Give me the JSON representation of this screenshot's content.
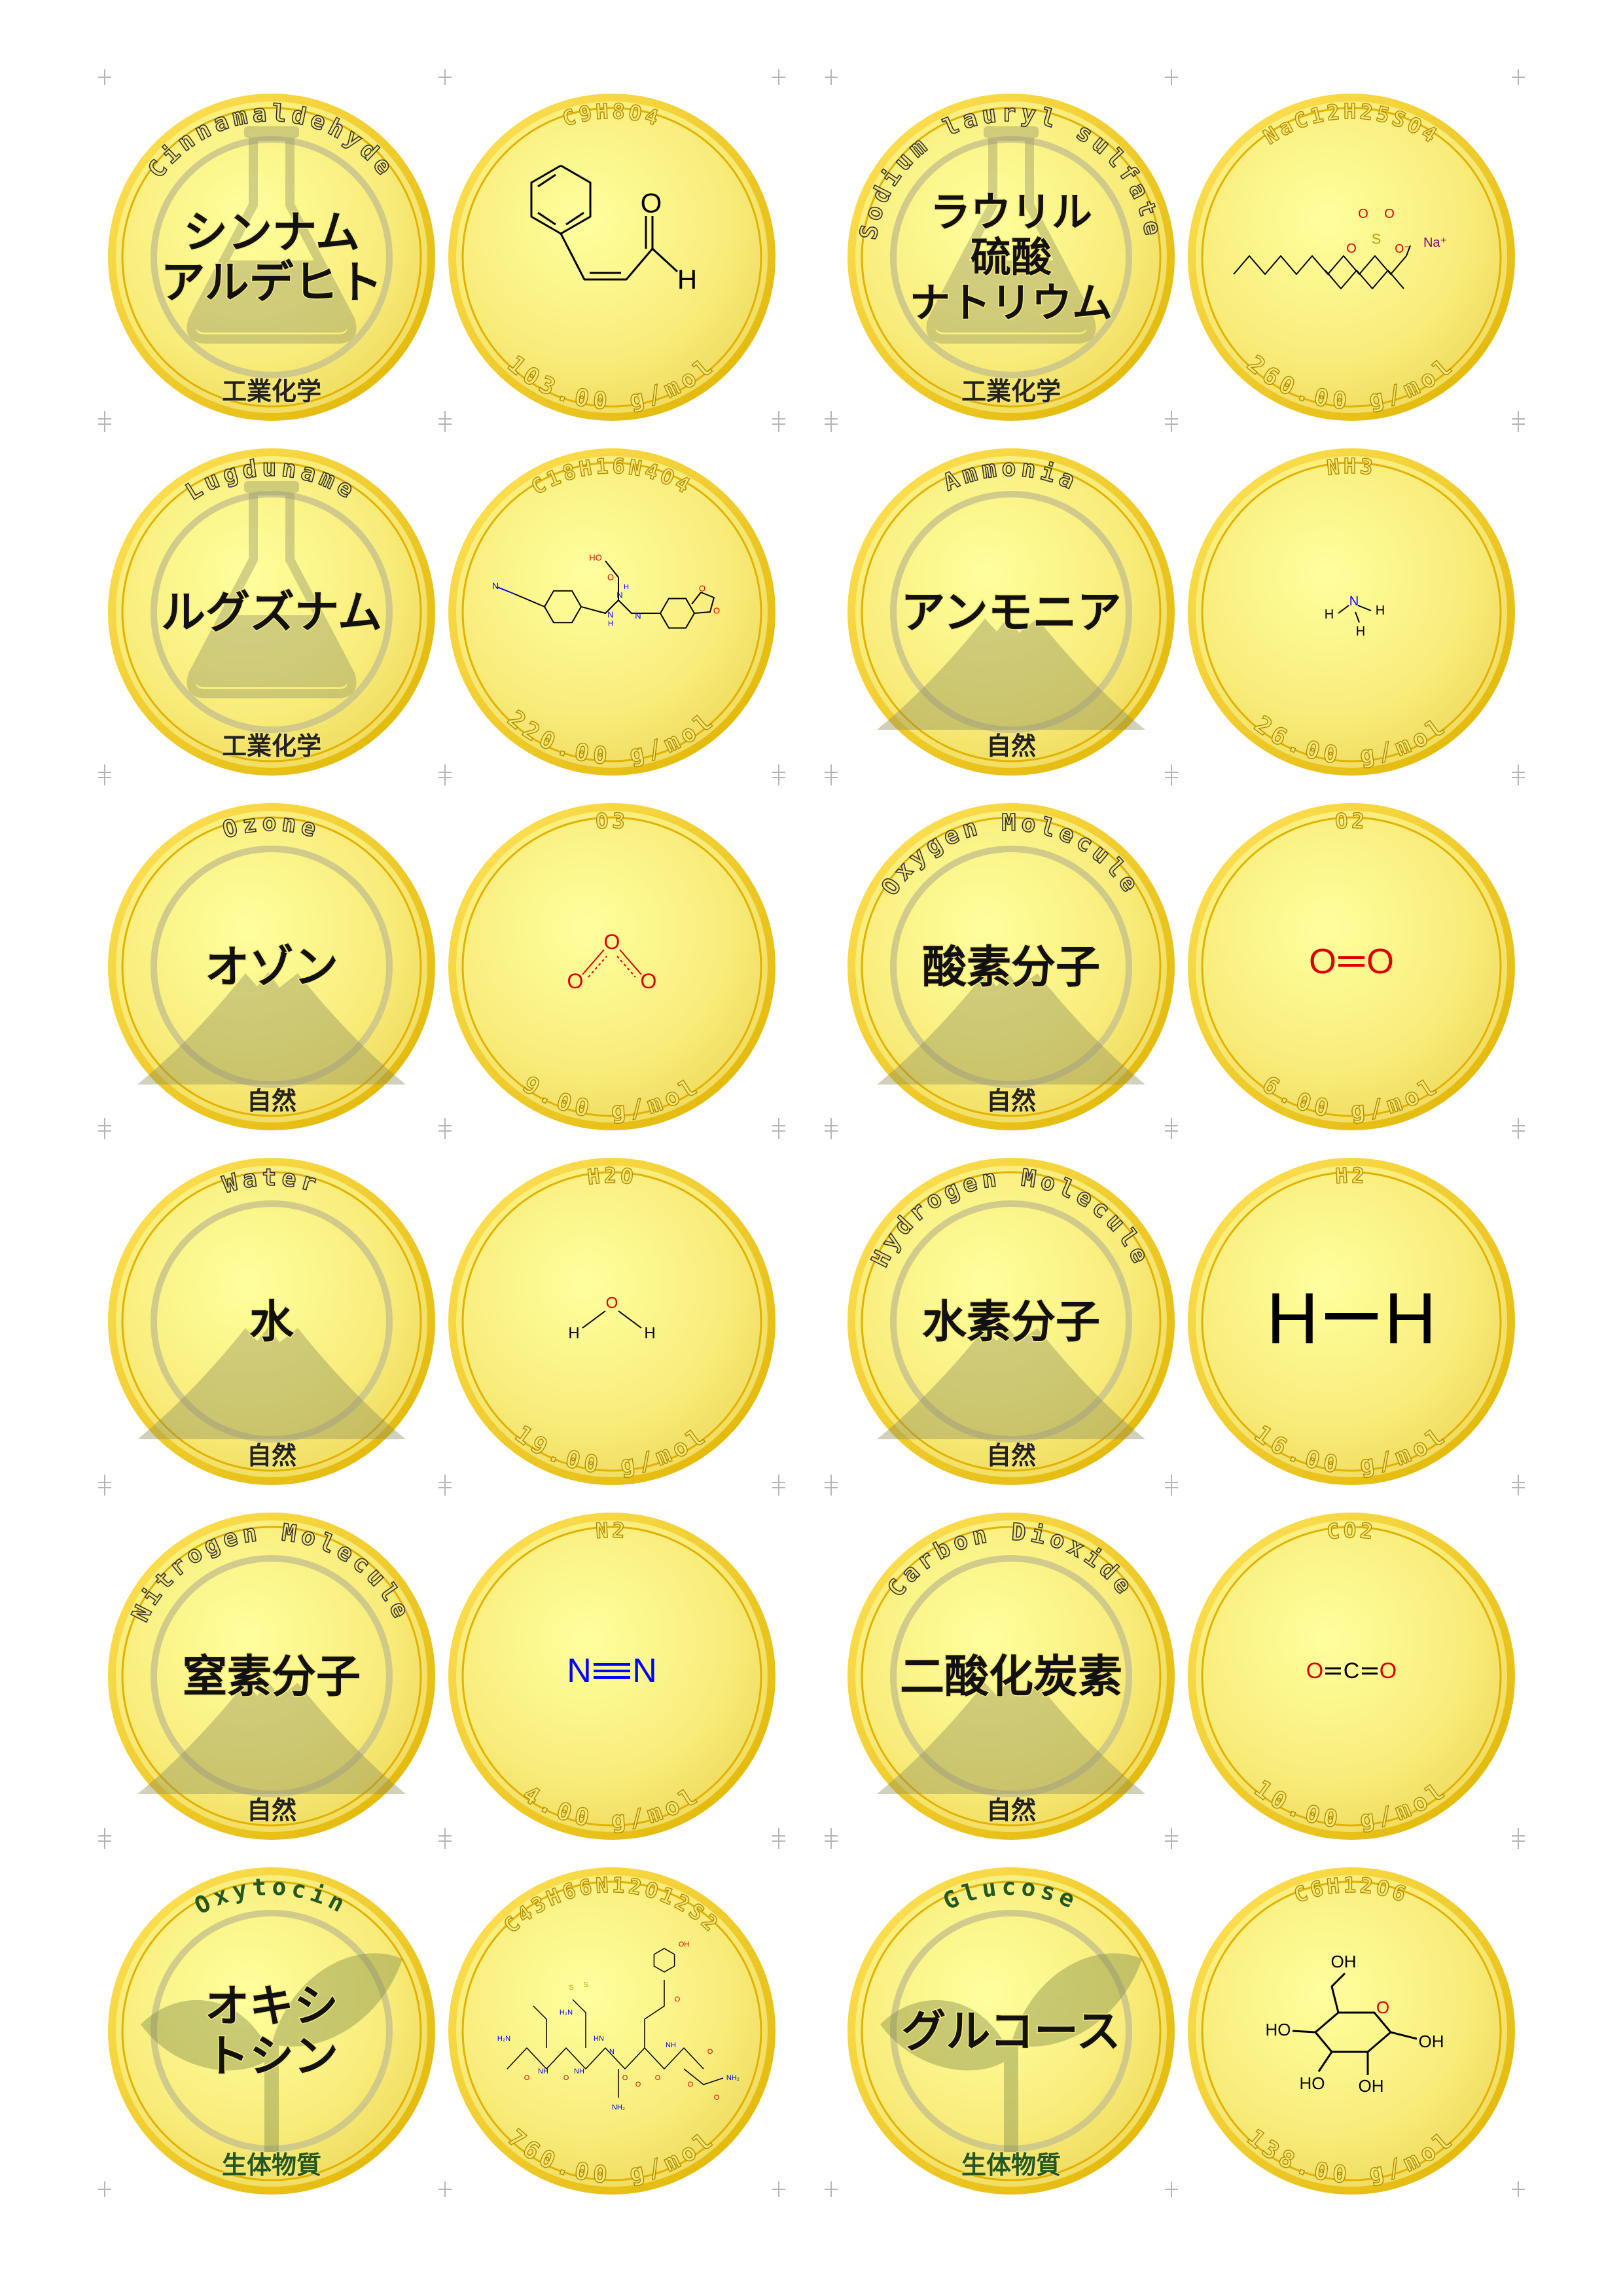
{
  "colors": {
    "coin_light": "#FFFF99",
    "coin_mid": "#F5E36A",
    "coin_rim": "#E6B800",
    "front_text": "#111111",
    "front_stroke_gold": "#F7E774",
    "bio_green": "#235723"
  },
  "coins": [
    {
      "en": "Cinnamaldehyde",
      "jp": [
        "シンナム",
        "アルデヒト"
      ],
      "category": "工業化学",
      "kind": "industrial",
      "icon": "flask-icon",
      "formula": "C9H8O4",
      "mass": "103.00 g/mol",
      "molecule": "cinnamaldehyde"
    },
    {
      "en": "Sodium lauryl sulfate",
      "jp": [
        "ラウリル",
        "硫酸",
        "ナトリウム"
      ],
      "category": "工業化学",
      "kind": "industrial",
      "icon": "flask-icon",
      "formula": "NaC12H25SO4",
      "mass": "260.00 g/mol",
      "molecule": "sls"
    },
    {
      "en": "Lugduname",
      "jp": [
        "ルグズナム"
      ],
      "category": "工業化学",
      "kind": "industrial",
      "icon": "flask-icon",
      "formula": "C18H16N4O4",
      "mass": "220.00 g/mol",
      "molecule": "lugduname"
    },
    {
      "en": "Ammonia",
      "jp": [
        "アンモニア"
      ],
      "category": "自然",
      "kind": "nature",
      "icon": "mountain-icon",
      "formula": "NH3",
      "mass": "26.00 g/mol",
      "molecule": "nh3"
    },
    {
      "en": "Ozone",
      "jp": [
        "オゾン"
      ],
      "category": "自然",
      "kind": "nature",
      "icon": "mountain-icon",
      "formula": "O3",
      "mass": "9.00 g/mol",
      "molecule": "o3"
    },
    {
      "en": "Oxygen Molecule",
      "jp": [
        "酸素分子"
      ],
      "category": "自然",
      "kind": "nature",
      "icon": "mountain-icon",
      "formula": "O2",
      "mass": "6.00 g/mol",
      "molecule": "o2"
    },
    {
      "en": "Water",
      "jp": [
        "水"
      ],
      "category": "自然",
      "kind": "nature",
      "icon": "mountain-icon",
      "formula": "H2O",
      "mass": "19.00 g/mol",
      "molecule": "h2o"
    },
    {
      "en": "Hydrogen Molecule",
      "jp": [
        "水素分子"
      ],
      "category": "自然",
      "kind": "nature",
      "icon": "mountain-icon",
      "formula": "H2",
      "mass": "16.00 g/mol",
      "molecule": "h2"
    },
    {
      "en": "Nitrogen Molecule",
      "jp": [
        "窒素分子"
      ],
      "category": "自然",
      "kind": "nature",
      "icon": "mountain-icon",
      "formula": "N2",
      "mass": "4.00 g/mol",
      "molecule": "n2"
    },
    {
      "en": "Carbon Dioxide",
      "jp": [
        "二酸化炭素"
      ],
      "category": "自然",
      "kind": "nature",
      "icon": "mountain-icon",
      "formula": "CO2",
      "mass": "10.00 g/mol",
      "molecule": "co2"
    },
    {
      "en": "Oxytocin",
      "jp": [
        "オキシ",
        "トシン"
      ],
      "category": "生体物質",
      "kind": "bio",
      "icon": "sprout-icon",
      "formula": "C43H66N12O12S2",
      "mass": "760.00 g/mol",
      "molecule": "oxytocin"
    },
    {
      "en": "Glucose",
      "jp": [
        "グルコース"
      ],
      "category": "生体物質",
      "kind": "bio",
      "icon": "sprout-icon",
      "formula": "C6H12O6",
      "mass": "138.00 g/mol",
      "molecule": "glucose"
    }
  ],
  "molecule_labels": {
    "cinnamaldehyde": [
      "O",
      "H"
    ],
    "sls": [
      "O",
      "S",
      "O",
      "O",
      "O⁻",
      "Na⁺"
    ],
    "lugduname": [
      "HO",
      "O",
      "N",
      "H",
      "N",
      "H",
      "N",
      "N",
      "O",
      "O"
    ],
    "nh3": [
      "N",
      "H",
      "H",
      "H"
    ],
    "o3": [
      "O",
      "O",
      "O"
    ],
    "o2": [
      "O",
      "O"
    ],
    "h2o": [
      "H",
      "O",
      "H"
    ],
    "h2": [
      "H",
      "H"
    ],
    "n2": [
      "N",
      "N"
    ],
    "co2": [
      "O",
      "C",
      "O"
    ],
    "oxytocin": [
      "OH",
      "H₂N",
      "O",
      "NH",
      "O",
      "NH",
      "HN",
      "O",
      "O",
      "S",
      "S",
      "H₂N",
      "O",
      "NH",
      "O",
      "N",
      "O",
      "O",
      "NH₂",
      "NH₂",
      "O"
    ],
    "glucose": [
      "OH",
      "O",
      "HO",
      "HO",
      "OH",
      "OH"
    ]
  }
}
